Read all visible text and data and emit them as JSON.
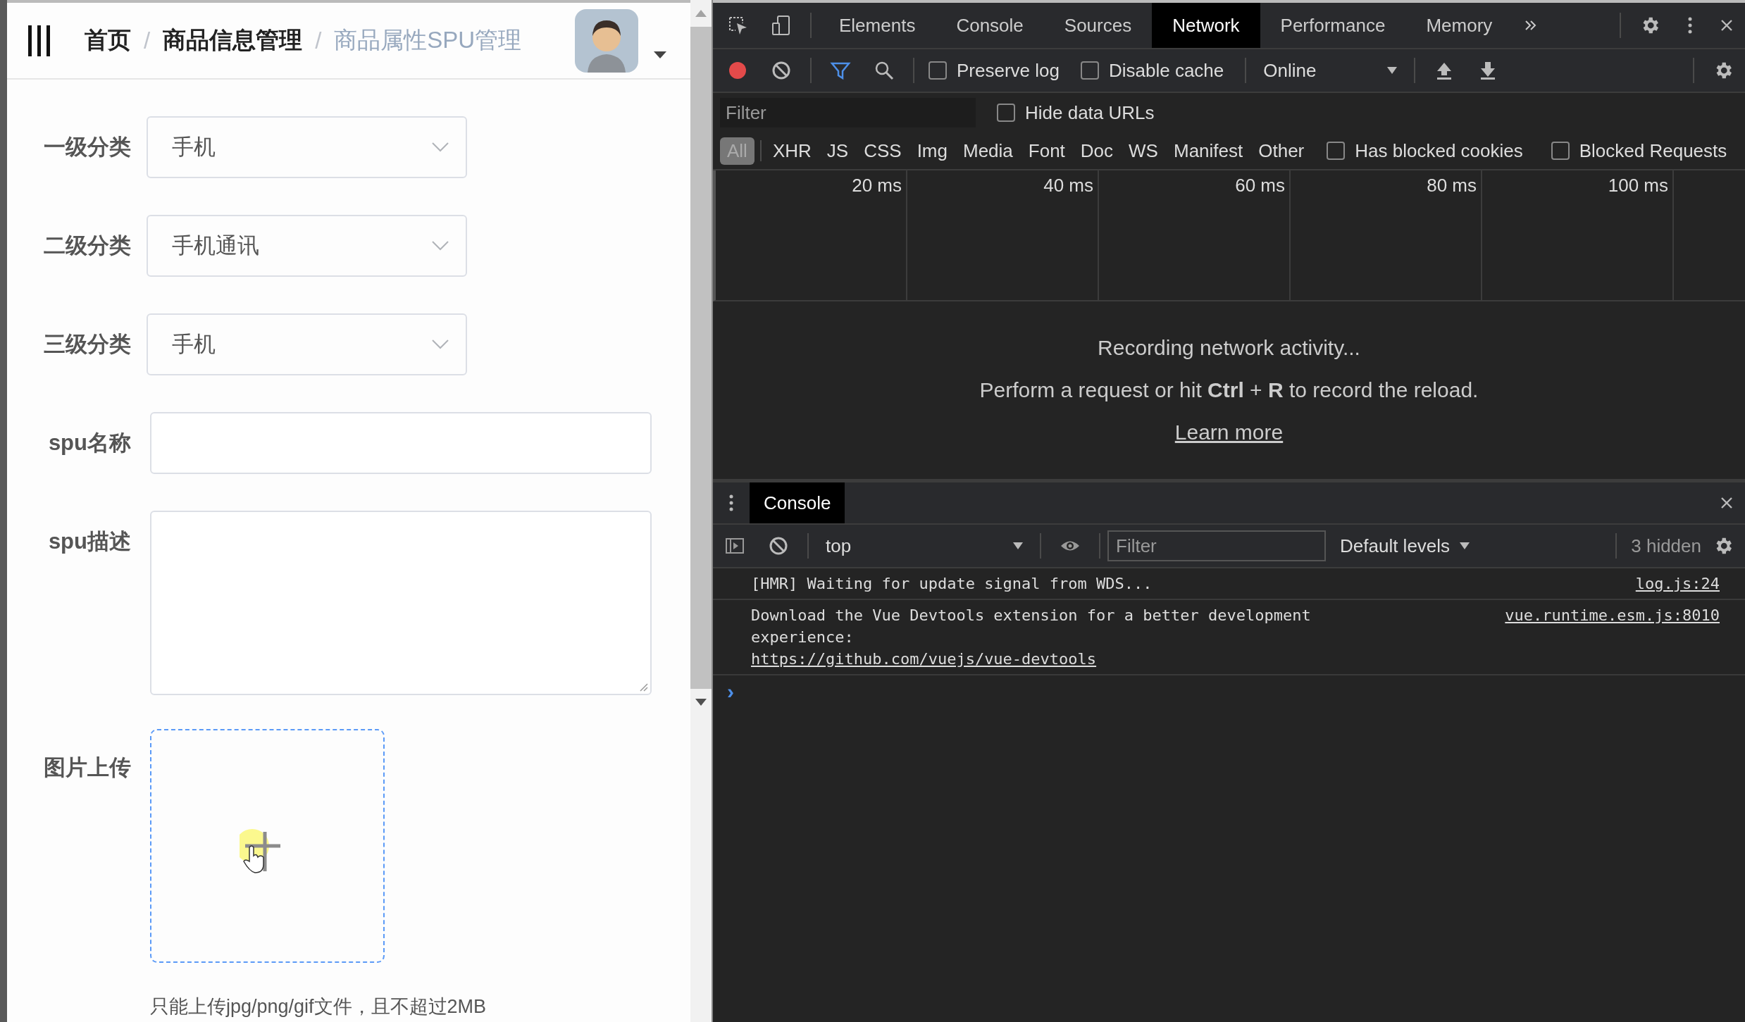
{
  "app": {
    "breadcrumb_separator": "/",
    "breadcrumb": [
      {
        "label": "首页",
        "current": false
      },
      {
        "label": "商品信息管理",
        "current": false
      },
      {
        "label": "商品属性SPU管理",
        "current": true
      }
    ],
    "form": [
      {
        "kind": "select",
        "label": "一级分类",
        "value": "手机"
      },
      {
        "kind": "select",
        "label": "二级分类",
        "value": "手机通讯"
      },
      {
        "kind": "select",
        "label": "三级分类",
        "value": "手机"
      },
      {
        "kind": "input",
        "label": "spu名称"
      },
      {
        "kind": "textarea",
        "label": "spu描述"
      },
      {
        "kind": "upload",
        "label": "图片上传",
        "hint": "只能上传jpg/png/gif文件，且不超过2MB"
      }
    ]
  },
  "devtools": {
    "tabs": [
      {
        "label": "Elements",
        "selected": false
      },
      {
        "label": "Console",
        "selected": false
      },
      {
        "label": "Sources",
        "selected": false
      },
      {
        "label": "Network",
        "selected": true
      },
      {
        "label": "Performance",
        "selected": false
      },
      {
        "label": "Memory",
        "selected": false
      }
    ],
    "toolbar": {
      "recording": true,
      "options": [
        {
          "label": "Preserve log",
          "checked": false
        },
        {
          "label": "Disable cache",
          "checked": false
        }
      ],
      "throttling": "Online"
    },
    "filter": {
      "placeholder": "Filter"
    },
    "hide_data_urls": {
      "label": "Hide data URLs",
      "checked": false
    },
    "types": [
      {
        "label": "All",
        "selected": true
      },
      {
        "label": "XHR",
        "selected": false
      },
      {
        "label": "JS",
        "selected": false
      },
      {
        "label": "CSS",
        "selected": false
      },
      {
        "label": "Img",
        "selected": false
      },
      {
        "label": "Media",
        "selected": false
      },
      {
        "label": "Font",
        "selected": false
      },
      {
        "label": "Doc",
        "selected": false
      },
      {
        "label": "WS",
        "selected": false
      },
      {
        "label": "Manifest",
        "selected": false
      },
      {
        "label": "Other",
        "selected": false
      }
    ],
    "type_options": [
      {
        "label": "Has blocked cookies",
        "checked": false
      },
      {
        "label": "Blocked Requests",
        "checked": false
      }
    ],
    "timeline_ticks": [
      "20 ms",
      "40 ms",
      "60 ms",
      "80 ms",
      "100 ms"
    ],
    "empty": {
      "title": "Recording network activity...",
      "hint": "Perform a request or hit **Ctrl** + **R** to record the reload.",
      "link": "Learn more"
    },
    "drawer": {
      "tabs": [
        {
          "label": "Console",
          "selected": true
        }
      ],
      "context": "top",
      "filter": {
        "placeholder": "Filter"
      },
      "levels": "Default levels",
      "hidden": "3 hidden",
      "messages": [
        {
          "text": "[HMR] Waiting for update signal from WDS...",
          "source": "log.js:24"
        },
        {
          "text": "Download the Vue Devtools extension for a better development experience:",
          "link": "https://github.com/vuejs/vue-devtools",
          "source": "vue.runtime.esm.js:8010"
        }
      ],
      "prompt": "›"
    }
  }
}
